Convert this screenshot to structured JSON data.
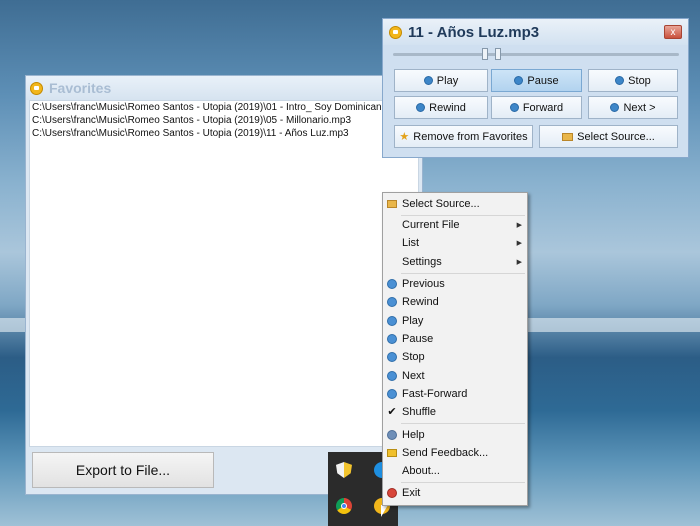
{
  "favorites": {
    "title": "Favorites",
    "items": [
      "C:\\Users\\franc\\Music\\Romeo Santos - Utopia (2019)\\01 - Intro_ Soy Dominicano",
      "C:\\Users\\franc\\Music\\Romeo Santos - Utopia (2019)\\05 - Millonario.mp3",
      "C:\\Users\\franc\\Music\\Romeo Santos - Utopia (2019)\\11 - Años Luz.mp3"
    ],
    "export_label": "Export to File..."
  },
  "player": {
    "title": "11 - Años Luz.mp3",
    "close": "x",
    "seek_fraction": 0.31,
    "volume_fraction": 0.045,
    "buttons": {
      "play": "Play",
      "pause": "Pause",
      "stop": "Stop",
      "rewind": "Rewind",
      "forward": "Forward",
      "next": "Next >",
      "remove_favorites": "Remove from Favorites",
      "select_source": "Select Source..."
    }
  },
  "menu": {
    "items": [
      {
        "label": "Select Source...",
        "icon": "folder-icon"
      },
      {
        "label": "Current File",
        "submenu": true
      },
      {
        "label": "List",
        "submenu": true
      },
      {
        "label": "Settings",
        "submenu": true
      },
      {
        "label": "Previous",
        "icon": "previous-icon"
      },
      {
        "label": "Rewind",
        "icon": "rewind-icon"
      },
      {
        "label": "Play",
        "icon": "play-icon"
      },
      {
        "label": "Pause",
        "icon": "pause-icon"
      },
      {
        "label": "Stop",
        "icon": "stop-icon"
      },
      {
        "label": "Next",
        "icon": "next-icon"
      },
      {
        "label": "Fast-Forward",
        "icon": "fast-forward-icon"
      },
      {
        "label": "Shuffle",
        "icon": "check-icon",
        "checked": true
      },
      {
        "label": "Help",
        "icon": "help-icon"
      },
      {
        "label": "Send Feedback...",
        "icon": "feedback-icon"
      },
      {
        "label": "About...",
        "icon": "about-icon"
      },
      {
        "label": "Exit",
        "icon": "exit-icon"
      }
    ]
  },
  "colors": {
    "accent": "#4a90d4",
    "window_bg": "#dce7f2",
    "menu_bg": "#f2f2f2"
  }
}
